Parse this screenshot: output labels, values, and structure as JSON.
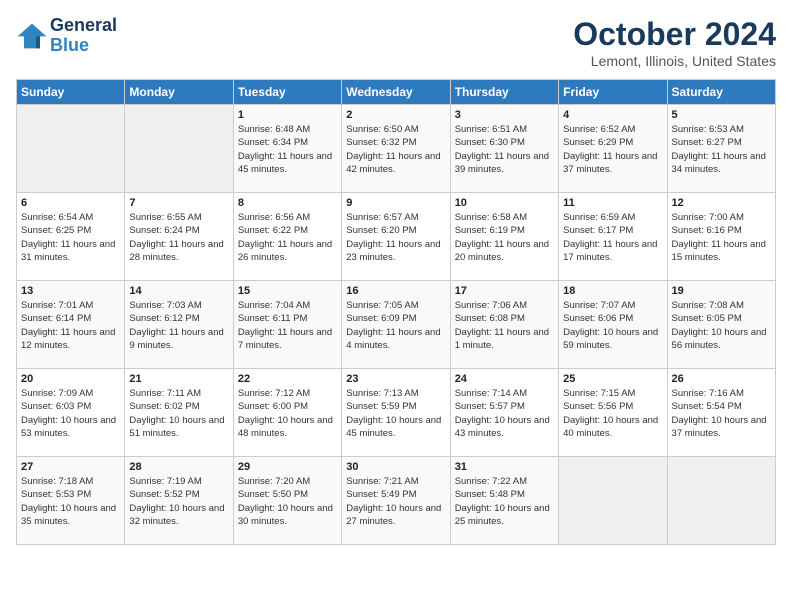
{
  "header": {
    "logo_line1": "General",
    "logo_line2": "Blue",
    "month": "October 2024",
    "location": "Lemont, Illinois, United States"
  },
  "days_of_week": [
    "Sunday",
    "Monday",
    "Tuesday",
    "Wednesday",
    "Thursday",
    "Friday",
    "Saturday"
  ],
  "weeks": [
    [
      {
        "num": "",
        "data": ""
      },
      {
        "num": "",
        "data": ""
      },
      {
        "num": "1",
        "data": "Sunrise: 6:48 AM\nSunset: 6:34 PM\nDaylight: 11 hours and 45 minutes."
      },
      {
        "num": "2",
        "data": "Sunrise: 6:50 AM\nSunset: 6:32 PM\nDaylight: 11 hours and 42 minutes."
      },
      {
        "num": "3",
        "data": "Sunrise: 6:51 AM\nSunset: 6:30 PM\nDaylight: 11 hours and 39 minutes."
      },
      {
        "num": "4",
        "data": "Sunrise: 6:52 AM\nSunset: 6:29 PM\nDaylight: 11 hours and 37 minutes."
      },
      {
        "num": "5",
        "data": "Sunrise: 6:53 AM\nSunset: 6:27 PM\nDaylight: 11 hours and 34 minutes."
      }
    ],
    [
      {
        "num": "6",
        "data": "Sunrise: 6:54 AM\nSunset: 6:25 PM\nDaylight: 11 hours and 31 minutes."
      },
      {
        "num": "7",
        "data": "Sunrise: 6:55 AM\nSunset: 6:24 PM\nDaylight: 11 hours and 28 minutes."
      },
      {
        "num": "8",
        "data": "Sunrise: 6:56 AM\nSunset: 6:22 PM\nDaylight: 11 hours and 26 minutes."
      },
      {
        "num": "9",
        "data": "Sunrise: 6:57 AM\nSunset: 6:20 PM\nDaylight: 11 hours and 23 minutes."
      },
      {
        "num": "10",
        "data": "Sunrise: 6:58 AM\nSunset: 6:19 PM\nDaylight: 11 hours and 20 minutes."
      },
      {
        "num": "11",
        "data": "Sunrise: 6:59 AM\nSunset: 6:17 PM\nDaylight: 11 hours and 17 minutes."
      },
      {
        "num": "12",
        "data": "Sunrise: 7:00 AM\nSunset: 6:16 PM\nDaylight: 11 hours and 15 minutes."
      }
    ],
    [
      {
        "num": "13",
        "data": "Sunrise: 7:01 AM\nSunset: 6:14 PM\nDaylight: 11 hours and 12 minutes."
      },
      {
        "num": "14",
        "data": "Sunrise: 7:03 AM\nSunset: 6:12 PM\nDaylight: 11 hours and 9 minutes."
      },
      {
        "num": "15",
        "data": "Sunrise: 7:04 AM\nSunset: 6:11 PM\nDaylight: 11 hours and 7 minutes."
      },
      {
        "num": "16",
        "data": "Sunrise: 7:05 AM\nSunset: 6:09 PM\nDaylight: 11 hours and 4 minutes."
      },
      {
        "num": "17",
        "data": "Sunrise: 7:06 AM\nSunset: 6:08 PM\nDaylight: 11 hours and 1 minute."
      },
      {
        "num": "18",
        "data": "Sunrise: 7:07 AM\nSunset: 6:06 PM\nDaylight: 10 hours and 59 minutes."
      },
      {
        "num": "19",
        "data": "Sunrise: 7:08 AM\nSunset: 6:05 PM\nDaylight: 10 hours and 56 minutes."
      }
    ],
    [
      {
        "num": "20",
        "data": "Sunrise: 7:09 AM\nSunset: 6:03 PM\nDaylight: 10 hours and 53 minutes."
      },
      {
        "num": "21",
        "data": "Sunrise: 7:11 AM\nSunset: 6:02 PM\nDaylight: 10 hours and 51 minutes."
      },
      {
        "num": "22",
        "data": "Sunrise: 7:12 AM\nSunset: 6:00 PM\nDaylight: 10 hours and 48 minutes."
      },
      {
        "num": "23",
        "data": "Sunrise: 7:13 AM\nSunset: 5:59 PM\nDaylight: 10 hours and 45 minutes."
      },
      {
        "num": "24",
        "data": "Sunrise: 7:14 AM\nSunset: 5:57 PM\nDaylight: 10 hours and 43 minutes."
      },
      {
        "num": "25",
        "data": "Sunrise: 7:15 AM\nSunset: 5:56 PM\nDaylight: 10 hours and 40 minutes."
      },
      {
        "num": "26",
        "data": "Sunrise: 7:16 AM\nSunset: 5:54 PM\nDaylight: 10 hours and 37 minutes."
      }
    ],
    [
      {
        "num": "27",
        "data": "Sunrise: 7:18 AM\nSunset: 5:53 PM\nDaylight: 10 hours and 35 minutes."
      },
      {
        "num": "28",
        "data": "Sunrise: 7:19 AM\nSunset: 5:52 PM\nDaylight: 10 hours and 32 minutes."
      },
      {
        "num": "29",
        "data": "Sunrise: 7:20 AM\nSunset: 5:50 PM\nDaylight: 10 hours and 30 minutes."
      },
      {
        "num": "30",
        "data": "Sunrise: 7:21 AM\nSunset: 5:49 PM\nDaylight: 10 hours and 27 minutes."
      },
      {
        "num": "31",
        "data": "Sunrise: 7:22 AM\nSunset: 5:48 PM\nDaylight: 10 hours and 25 minutes."
      },
      {
        "num": "",
        "data": ""
      },
      {
        "num": "",
        "data": ""
      }
    ]
  ]
}
